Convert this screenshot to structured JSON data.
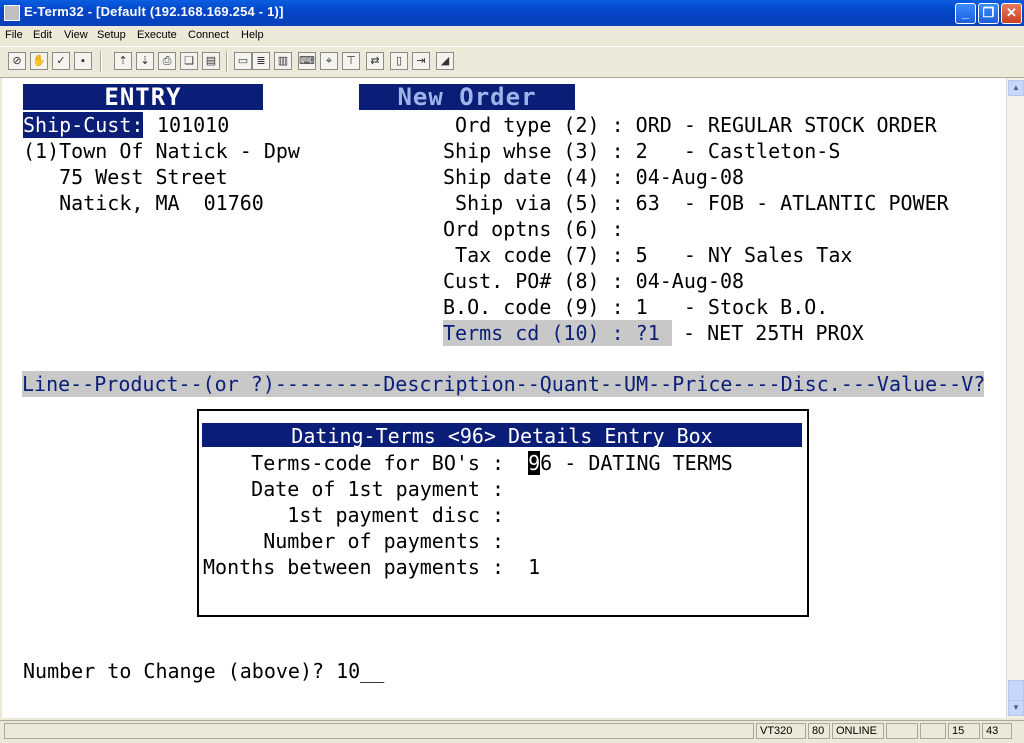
{
  "window": {
    "title": "E-Term32 - [Default (192.168.169.254 - 1)]"
  },
  "menu": [
    "File",
    "Edit",
    "View",
    "Setup",
    "Execute",
    "Connect",
    "Help"
  ],
  "terminal": {
    "entry_label": "ENTRY",
    "new_order_label": "New Order",
    "ship_cust_label": "Ship-Cust:",
    "ship_cust_value": "101010",
    "address": [
      "(1)Town Of Natick - Dpw",
      "   75 West Street",
      "   Natick, MA  01760"
    ],
    "fields": [
      " Ord type (2) : ORD - REGULAR STOCK ORDER",
      "Ship whse (3) : 2   - Castleton-S",
      "Ship date (4) : 04-Aug-08",
      " Ship via (5) : 63  - FOB - ATLANTIC POWER",
      "Ord optns (6) :",
      " Tax code (7) : 5   - NY Sales Tax",
      "Cust. PO# (8) : 04-Aug-08",
      "B.O. code (9) : 1   - Stock B.O."
    ],
    "terms_label": "Terms cd (10) : ?1 ",
    "terms_desc": " - NET 25TH PROX",
    "column_header": "Line--Product--(or ?)---------Description--Quant--UM--Price----Disc.---Value--V?",
    "dialog": {
      "title": "Dating-Terms <96> Details Entry Box",
      "rows": [
        {
          "label": "    Terms-code for BO's :",
          "value_cursor": "9",
          "value": "6 - DATING TERMS"
        },
        {
          "label": "    Date of 1st payment :",
          "value_cursor": "",
          "value": ""
        },
        {
          "label": "       1st payment disc :",
          "value_cursor": "",
          "value": ""
        },
        {
          "label": "     Number of payments :",
          "value_cursor": "",
          "value": ""
        },
        {
          "label": "Months between payments :",
          "value_cursor": "",
          "value": "1"
        }
      ]
    },
    "prompt": "Number to Change (above)? 10__"
  },
  "status": {
    "emulation": "VT320",
    "columns": "80",
    "state": "ONLINE",
    "row": "15",
    "col": "43"
  }
}
